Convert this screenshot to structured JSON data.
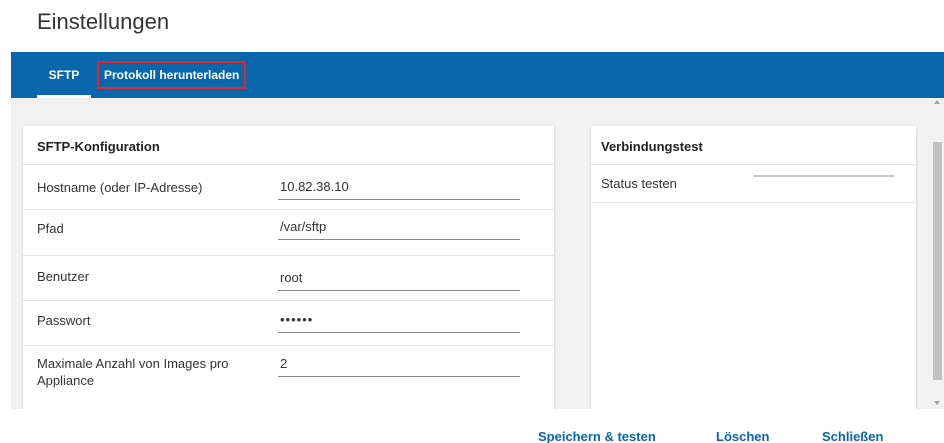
{
  "page": {
    "title": "Einstellungen"
  },
  "tabs": [
    {
      "label": "SFTP",
      "active": true
    },
    {
      "label": "Protokoll herunterladen",
      "highlighted": true
    }
  ],
  "sftp_config": {
    "title": "SFTP-Konfiguration",
    "fields": [
      {
        "label": "Hostname (oder IP-Adresse)",
        "value": "10.82.38.10"
      },
      {
        "label": "Pfad",
        "value": "/var/sftp"
      },
      {
        "label": "Benutzer",
        "value": "root"
      },
      {
        "label": "Passwort",
        "value": "••••••"
      },
      {
        "label_line1": "Maximale Anzahl von Images pro",
        "label_line2": "Appliance",
        "value": "2"
      }
    ]
  },
  "connection_test": {
    "title": "Verbindungstest",
    "status_label": "Status testen",
    "progress": 0
  },
  "footer": {
    "save_test_label": "Speichern & testen",
    "delete_label": "Löschen",
    "close_label": "Schließen"
  },
  "colors": {
    "accent": "#0a66ab",
    "highlight_border": "#e0272b",
    "background": "#f1f1f1"
  }
}
